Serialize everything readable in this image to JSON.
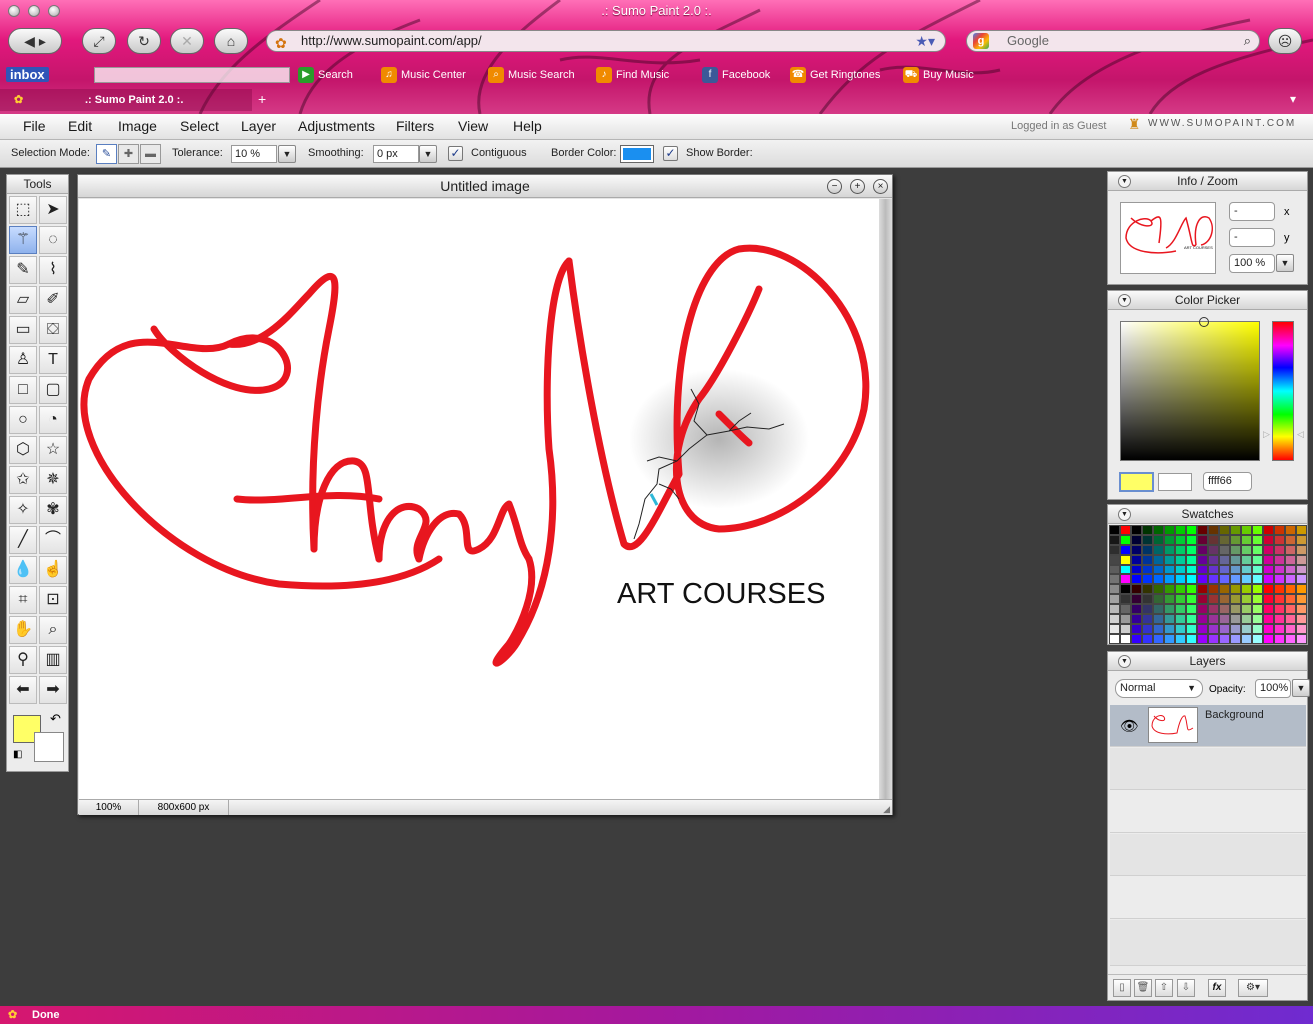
{
  "browser": {
    "title": ".: Sumo Paint 2.0 :.",
    "url": "http://www.sumopaint.com/app/",
    "search_placeholder": "Google",
    "tab_title": ".: Sumo Paint 2.0 :.",
    "status": "Done",
    "inbox_label": "inbox",
    "bookmarks": [
      "Search",
      "Music Center",
      "Music Search",
      "Find Music",
      "Facebook",
      "Get Ringtones",
      "Buy Music"
    ]
  },
  "menubar": {
    "items": [
      "File",
      "Edit",
      "Image",
      "Select",
      "Layer",
      "Adjustments",
      "Filters",
      "View",
      "Help"
    ],
    "login_status": "Logged in as Guest",
    "site": "WWW.SUMOPAINT.COM"
  },
  "options": {
    "selection_mode_label": "Selection Mode:",
    "tolerance_label": "Tolerance:",
    "tolerance_value": "10 %",
    "smoothing_label": "Smoothing:",
    "smoothing_value": "0 px",
    "contiguous_label": "Contiguous",
    "border_color_label": "Border Color:",
    "border_color": "#1a8ff0",
    "show_border_label": "Show Border:"
  },
  "tools": {
    "title": "Tools",
    "icons": [
      "marquee-select-icon",
      "move-arrow-icon",
      "magic-wand-icon",
      "lasso-icon",
      "pencil-icon",
      "brush-icon",
      "eraser-icon",
      "smudge-icon",
      "gradient-icon",
      "paint-bucket-icon",
      "clone-stamp-icon",
      "text-icon",
      "rectangle-icon",
      "rounded-rectangle-icon",
      "ellipse-icon",
      "arc-icon",
      "polygon-icon",
      "star-icon",
      "star-outline-icon",
      "burst-icon",
      "shape-icon",
      "flower-icon",
      "line-icon",
      "curve-icon",
      "blur-drop-icon",
      "finger-smudge-icon",
      "crop-icon",
      "transform-icon",
      "hand-icon",
      "zoom-icon",
      "eyedropper-icon",
      "trash-icon",
      "undo-arrow-icon",
      "redo-arrow-icon"
    ],
    "foreground_color": "#ffff66",
    "background_color": "#ffffff"
  },
  "image_window": {
    "title": "Untitled image",
    "zoom": "100%",
    "size": "800x600 px",
    "art_text": "ART COURSES"
  },
  "info_zoom": {
    "title": "Info / Zoom",
    "x_value": "-",
    "y_value": "-",
    "x_label": "x",
    "y_label": "y",
    "zoom_value": "100 %"
  },
  "color_picker": {
    "title": "Color Picker",
    "hex_value": "ffff66",
    "primary_color": "#ffff66",
    "secondary_color": "#ffffff"
  },
  "swatches": {
    "title": "Swatches"
  },
  "layers": {
    "title": "Layers",
    "blend_mode": "Normal",
    "opacity_label": "Opacity:",
    "opacity_value": "100%",
    "items": [
      {
        "name": "Background"
      }
    ]
  }
}
